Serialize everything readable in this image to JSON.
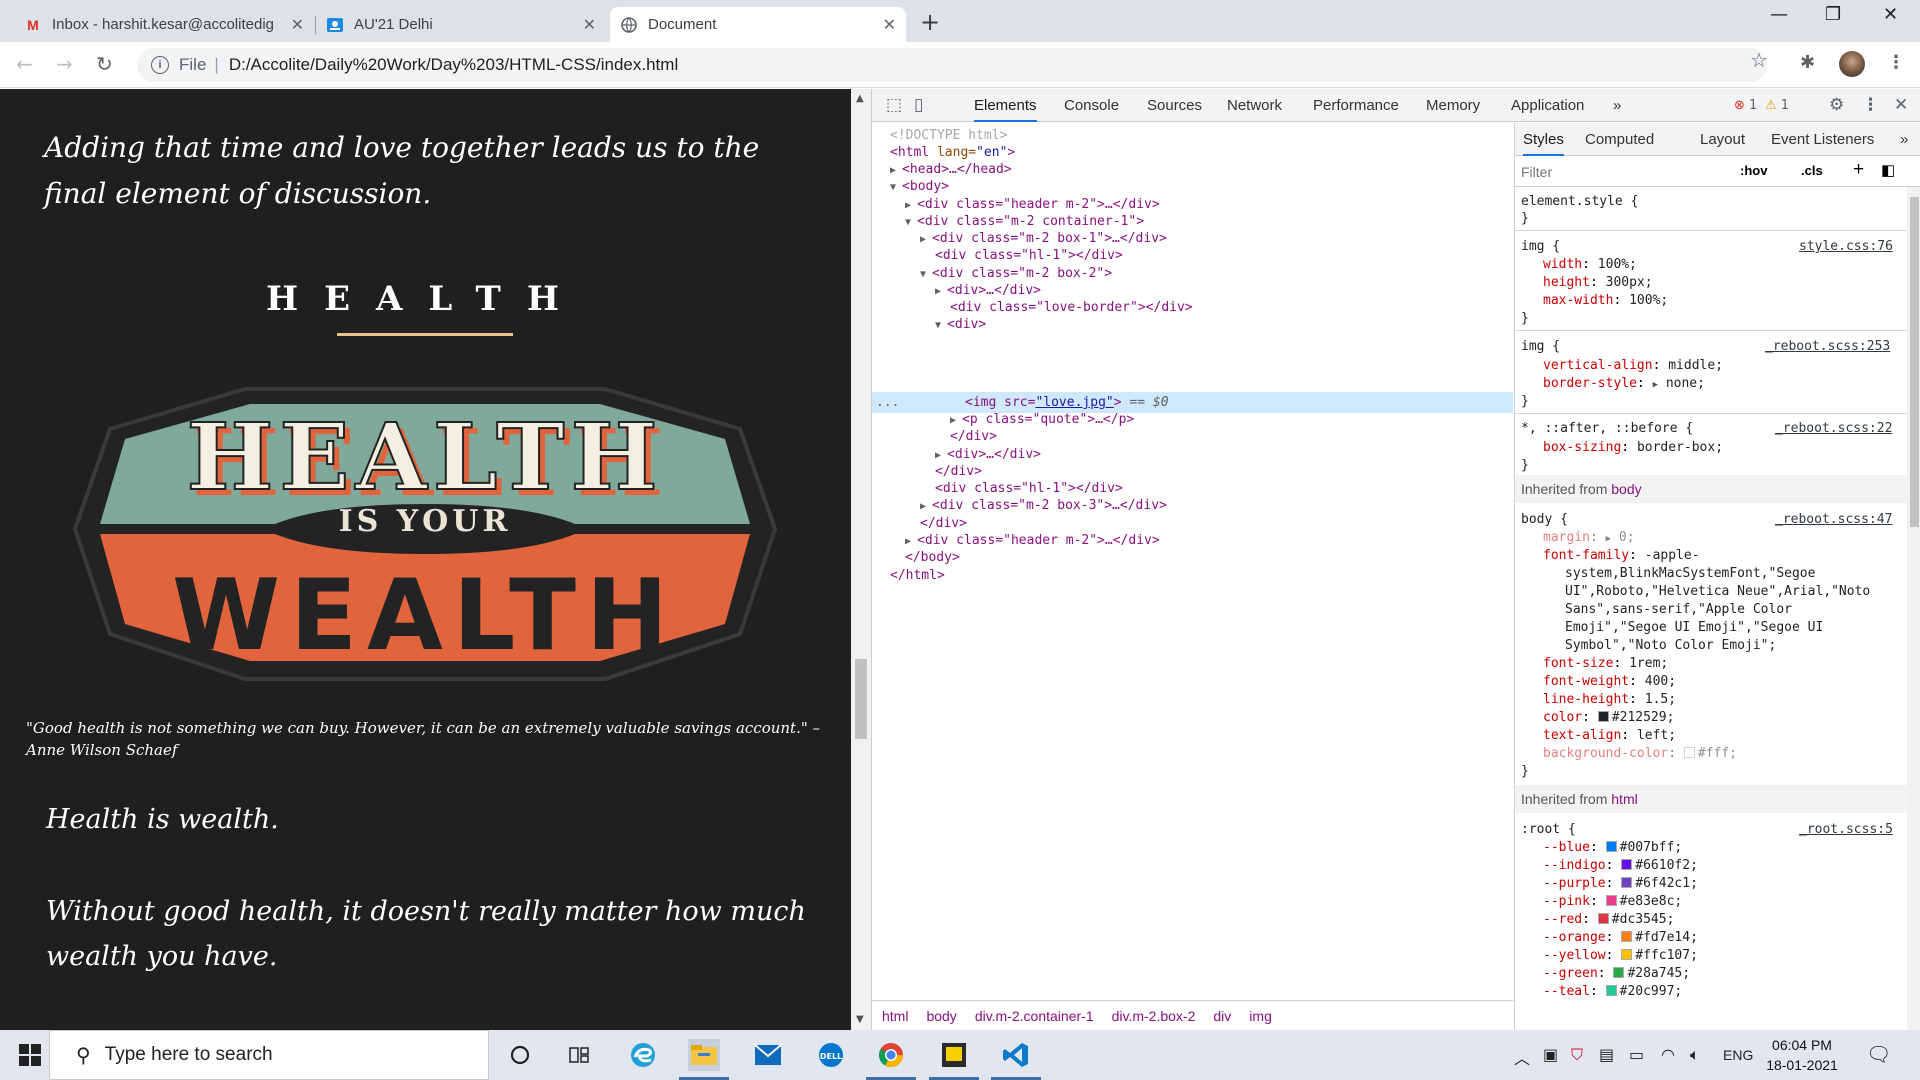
{
  "browser": {
    "tabs": [
      {
        "label": "Inbox - harshit.kesar@accolitedig",
        "icon": "gmail-icon"
      },
      {
        "label": "AU'21 Delhi",
        "icon": "classroom-icon"
      },
      {
        "label": "Document",
        "icon": "globe-icon"
      }
    ],
    "file_label": "File",
    "url": "D:/Accolite/Daily%20Work/Day%203/HTML-CSS/index.html"
  },
  "page": {
    "intro": "Adding that time and love together leads us to the final element of discussion.",
    "heading": "HEALTH",
    "badge": {
      "line1": "HEALTH",
      "line2": "IS YOUR",
      "line3": "WEALTH"
    },
    "quote": "\"Good health is not something we can buy. However, it can be an extremely valuable savings account.\" – Anne Wilson Schaef",
    "p1": "Health is wealth.",
    "p2": "Without good health, it doesn't really matter how much wealth you have."
  },
  "devtools": {
    "tabs": [
      "Elements",
      "Console",
      "Sources",
      "Network",
      "Performance",
      "Memory",
      "Application"
    ],
    "more": "»",
    "errors": "1",
    "warnings": "1",
    "dom_selected_suffix": "== $0",
    "dom_selected_dots": "...",
    "dom": {
      "doctype": "<!DOCTYPE html>",
      "html_open_tag": "<html",
      "html_lang_attr": " lang=",
      "html_lang_val": "\"en\"",
      "html_open_close": ">",
      "head": "<head>…</head>",
      "body_open": "<body>",
      "l1": "<div class=\"header m-2\">…</div>",
      "l2": "<div class=\"m-2 container-1\">",
      "l3": "<div class=\"m-2 box-1\">…</div>",
      "l4": "<div class=\"hl-1\"></div>",
      "l5": "<div class=\"m-2 box-2\">",
      "l6": "<div>…</div>",
      "l7": "<div class=\"love-border\"></div>",
      "l8": "<div>",
      "img_open": "<img src=",
      "img_src": "\"love.jpg\"",
      "img_close": ">",
      "l10": "<p class=\"quote\">…</p>",
      "l11": "</div>",
      "l12": "<div>…</div>",
      "l13": "</div>",
      "l14": "<div class=\"hl-1\"></div>",
      "l15": "<div class=\"m-2 box-3\">…</div>",
      "l16": "</div>",
      "l17": "<div class=\"header m-2\">…</div>",
      "body_close": "</body>",
      "html_close": "</html>"
    },
    "breadcrumbs": [
      "html",
      "body",
      "div.m-2.container-1",
      "div.m-2.box-2",
      "div",
      "img"
    ],
    "styles_tabs": [
      "Styles",
      "Computed",
      "Layout",
      "Event Listeners"
    ],
    "styles_more": "»",
    "filter_placeholder": "Filter",
    "hov": ":hov",
    "cls": ".cls",
    "plus": "+",
    "rules": {
      "element_style": "element.style {",
      "close": "}",
      "img1_sel": "img {",
      "img1_src": "style.css:76",
      "img1_p1": "width",
      "img1_v1": "100%;",
      "img1_p2": "height",
      "img1_v2": "300px;",
      "img1_p3": "max-width",
      "img1_v3": "100%;",
      "img2_sel": "img {",
      "img2_src": "_reboot.scss:253",
      "img2_p1": "vertical-align",
      "img2_v1": "middle;",
      "img2_p2": "border-style",
      "img2_v2": "none;",
      "star_sel": "*, ::after, ::before {",
      "star_src": "_reboot.scss:22",
      "star_p1": "box-sizing",
      "star_v1": "border-box;",
      "inherited_body_label": "Inherited from ",
      "inherited_body_tag": "body",
      "body_sel": "body {",
      "body_src": "_reboot.scss:47",
      "body_margin": "margin",
      "body_margin_v": "0;",
      "body_ff": "font-family",
      "body_ff_v1": "-apple-",
      "body_ff_v2": "system,BlinkMacSystemFont,\"Segoe",
      "body_ff_v3": "UI\",Roboto,\"Helvetica Neue\",Arial,\"Noto",
      "body_ff_v4": "Sans\",sans-serif,\"Apple Color",
      "body_ff_v5": "Emoji\",\"Segoe UI Emoji\",\"Segoe UI",
      "body_ff_v6": "Symbol\",\"Noto Color Emoji\";",
      "body_fs": "font-size",
      "body_fs_v": "1rem;",
      "body_fw": "font-weight",
      "body_fw_v": "400;",
      "body_lh": "line-height",
      "body_lh_v": "1.5;",
      "body_color": "color",
      "body_color_v": "#212529;",
      "body_ta": "text-align",
      "body_ta_v": "left;",
      "body_bg": "background-color",
      "body_bg_v": "#fff;",
      "inherited_html_label": "Inherited from ",
      "inherited_html_tag": "html",
      "root_sel": ":root {",
      "root_src": "_root.scss:5",
      "vars": [
        {
          "name": "--blue",
          "value": "#007bff;",
          "color": "#007bff"
        },
        {
          "name": "--indigo",
          "value": "#6610f2;",
          "color": "#6610f2"
        },
        {
          "name": "--purple",
          "value": "#6f42c1;",
          "color": "#6f42c1"
        },
        {
          "name": "--pink",
          "value": "#e83e8c;",
          "color": "#e83e8c"
        },
        {
          "name": "--red",
          "value": "#dc3545;",
          "color": "#dc3545"
        },
        {
          "name": "--orange",
          "value": "#fd7e14;",
          "color": "#fd7e14"
        },
        {
          "name": "--yellow",
          "value": "#ffc107;",
          "color": "#ffc107"
        },
        {
          "name": "--green",
          "value": "#28a745;",
          "color": "#28a745"
        },
        {
          "name": "--teal",
          "value": "#20c997;",
          "color": "#20c997"
        }
      ]
    }
  },
  "taskbar": {
    "search_placeholder": "Type here to search",
    "lang": "ENG",
    "time": "06:04 PM",
    "date": "18-01-2021"
  },
  "colors": {
    "page_bg": "#201f1f",
    "badge_teal": "#7fa99a",
    "badge_orange": "#e2643c",
    "badge_dark": "#232323",
    "accent": "#1a73e8"
  }
}
